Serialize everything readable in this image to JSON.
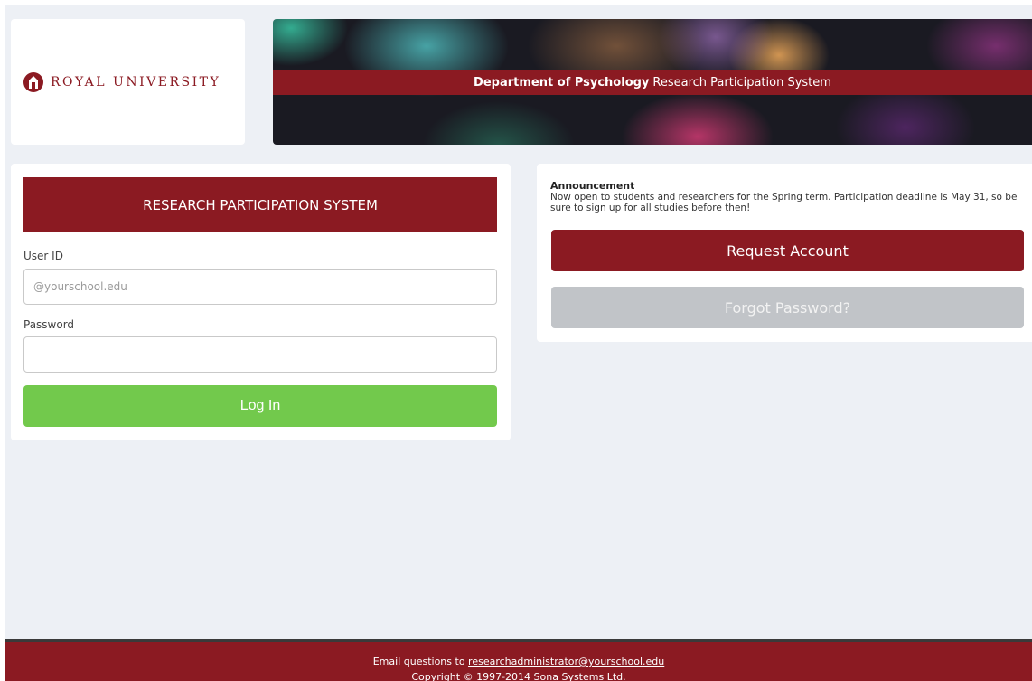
{
  "header": {
    "logo_text": "ROYAL UNIVERSITY",
    "banner_bold": "Department of Psychology",
    "banner_rest": "Research Participation System"
  },
  "login": {
    "title": "RESEARCH PARTICIPATION SYSTEM",
    "user_id_label": "User ID",
    "user_id_placeholder": "@yourschool.edu",
    "user_id_value": "",
    "password_label": "Password",
    "password_value": "",
    "login_button": "Log In"
  },
  "announcement": {
    "title": "Announcement",
    "body": "Now open to students and researchers for the Spring term. Participation deadline is May 31, so be sure to sign up for all studies before then!",
    "request_button": "Request Account",
    "forgot_button": "Forgot Password?"
  },
  "footer": {
    "email_prefix": "Email questions to ",
    "email_link": "researchadministrator@yourschool.edu",
    "copyright": "Copyright © 1997-2014 Sona Systems Ltd."
  },
  "colors": {
    "brand": "#8b1a22",
    "login_button": "#72c94c",
    "disabled_button": "#c1c4c8",
    "background": "#edf0f5"
  },
  "icons": {
    "logo": "university-crest-icon"
  }
}
